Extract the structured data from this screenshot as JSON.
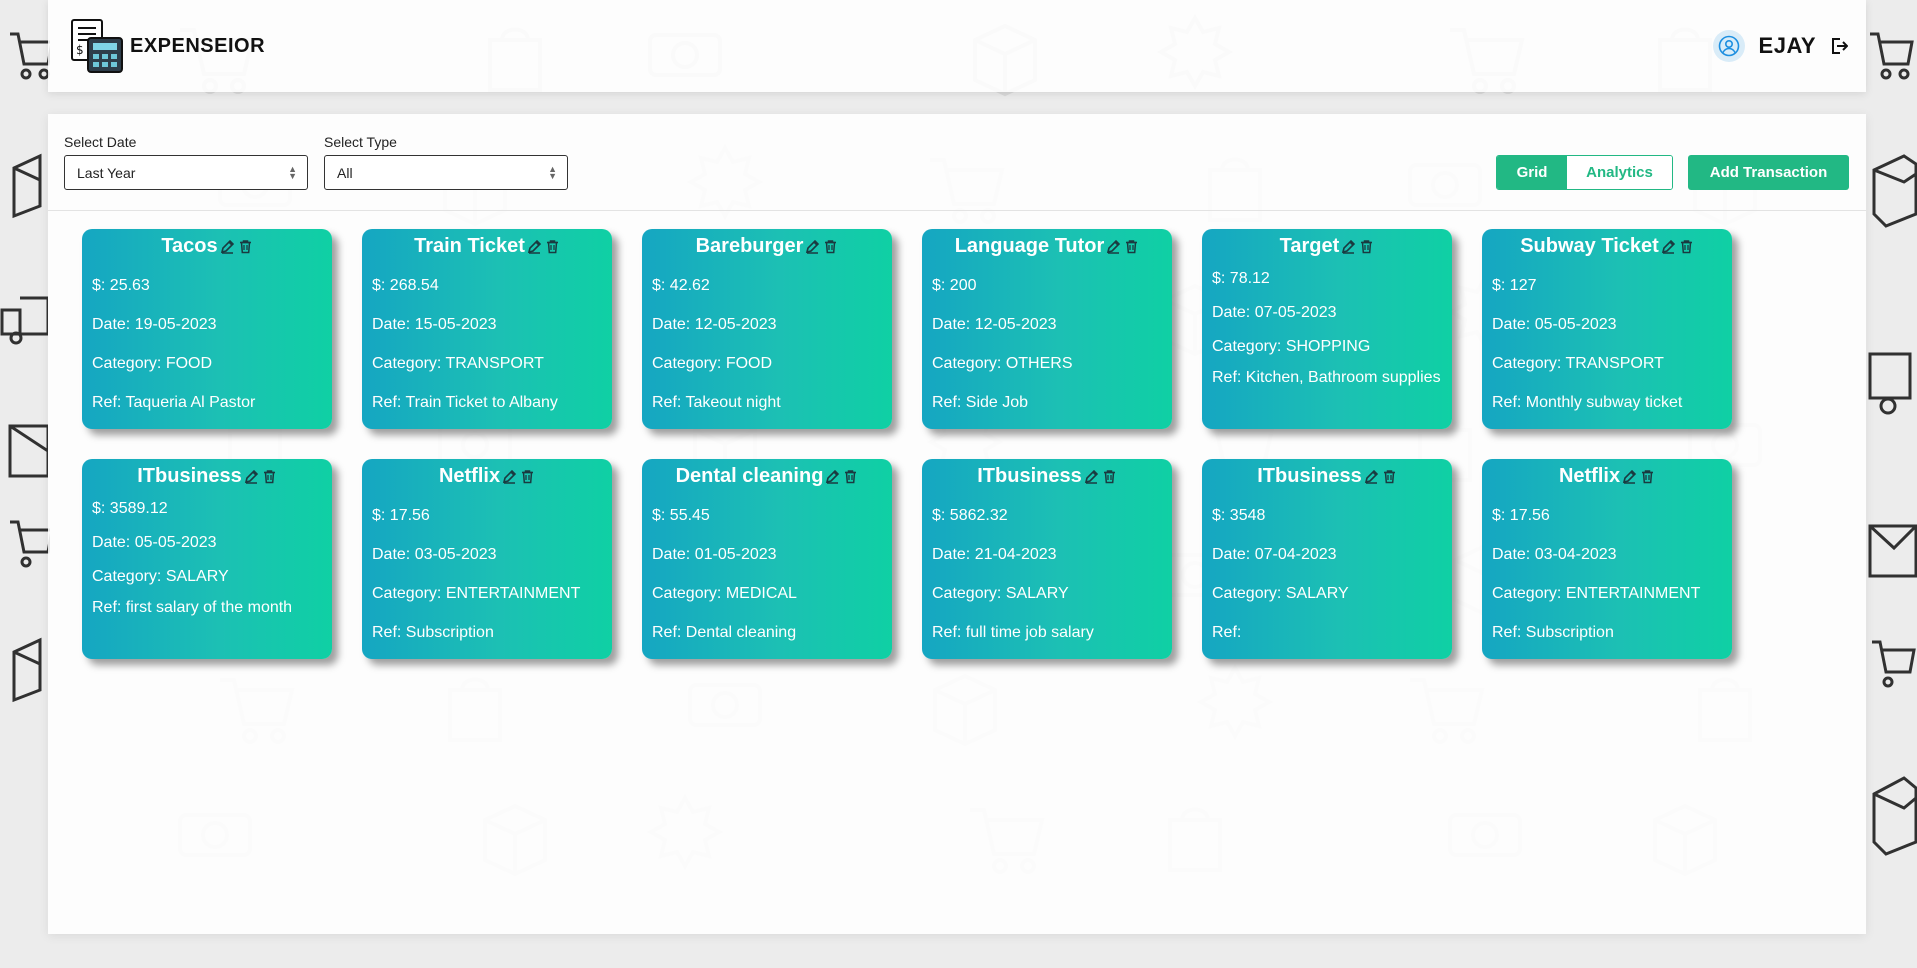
{
  "app": {
    "title": "EXPENSEIOR"
  },
  "user": {
    "name": "EJAY"
  },
  "filters": {
    "date": {
      "label": "Select Date",
      "value": "Last Year"
    },
    "type": {
      "label": "Select Type",
      "value": "All"
    }
  },
  "view_toggle": {
    "grid_label": "Grid",
    "analytics_label": "Analytics",
    "active": "grid"
  },
  "actions": {
    "add_label": "Add Transaction"
  },
  "colors": {
    "accent": "#22b884",
    "card_gradient_start": "#15a6c2",
    "card_gradient_end": "#0fd0a4"
  },
  "transactions": [
    {
      "title": "Tacos",
      "amount": "$: 25.63",
      "date": "Date: 19-05-2023",
      "category": "Category: FOOD",
      "ref": "Ref: Taqueria Al Pastor"
    },
    {
      "title": "Train Ticket",
      "amount": "$: 268.54",
      "date": "Date: 15-05-2023",
      "category": "Category: TRANSPORT",
      "ref": "Ref: Train Ticket to Albany"
    },
    {
      "title": "Bareburger",
      "amount": "$: 42.62",
      "date": "Date: 12-05-2023",
      "category": "Category: FOOD",
      "ref": "Ref: Takeout night"
    },
    {
      "title": "Language Tutor",
      "amount": "$: 200",
      "date": "Date: 12-05-2023",
      "category": "Category: OTHERS",
      "ref": "Ref: Side Job"
    },
    {
      "title": "Target",
      "amount": "$: 78.12",
      "date": "Date: 07-05-2023",
      "category": "Category: SHOPPING",
      "ref": "Ref: Kitchen, Bathroom supplies"
    },
    {
      "title": "Subway Ticket",
      "amount": "$: 127",
      "date": "Date: 05-05-2023",
      "category": "Category: TRANSPORT",
      "ref": "Ref: Monthly subway ticket"
    },
    {
      "title": "ITbusiness",
      "amount": "$: 3589.12",
      "date": "Date: 05-05-2023",
      "category": "Category: SALARY",
      "ref": "Ref: first salary of the month"
    },
    {
      "title": "Netflix",
      "amount": "$: 17.56",
      "date": "Date: 03-05-2023",
      "category": "Category: ENTERTAINMENT",
      "ref": "Ref: Subscription"
    },
    {
      "title": "Dental cleaning",
      "amount": "$: 55.45",
      "date": "Date: 01-05-2023",
      "category": "Category: MEDICAL",
      "ref": "Ref: Dental cleaning"
    },
    {
      "title": "ITbusiness",
      "amount": "$: 5862.32",
      "date": "Date: 21-04-2023",
      "category": "Category: SALARY",
      "ref": "Ref: full time job salary"
    },
    {
      "title": "ITbusiness",
      "amount": "$: 3548",
      "date": "Date: 07-04-2023",
      "category": "Category: SALARY",
      "ref": "Ref:"
    },
    {
      "title": "Netflix",
      "amount": "$: 17.56",
      "date": "Date: 03-04-2023",
      "category": "Category: ENTERTAINMENT",
      "ref": "Ref: Subscription"
    }
  ],
  "icons": {
    "logo": "calculator-receipt-icon",
    "user": "user-circle-icon",
    "logout": "logout-icon",
    "edit": "pencil-icon",
    "delete": "trash-icon",
    "background": [
      "shopping-cart-icon",
      "sale-tag-icon",
      "hot-price-badge-icon",
      "shopping-bag-icon",
      "dollar-bill-icon",
      "credit-card-icon",
      "box-icon",
      "delivery-truck-icon",
      "envelope-icon",
      "basket-icon"
    ]
  }
}
